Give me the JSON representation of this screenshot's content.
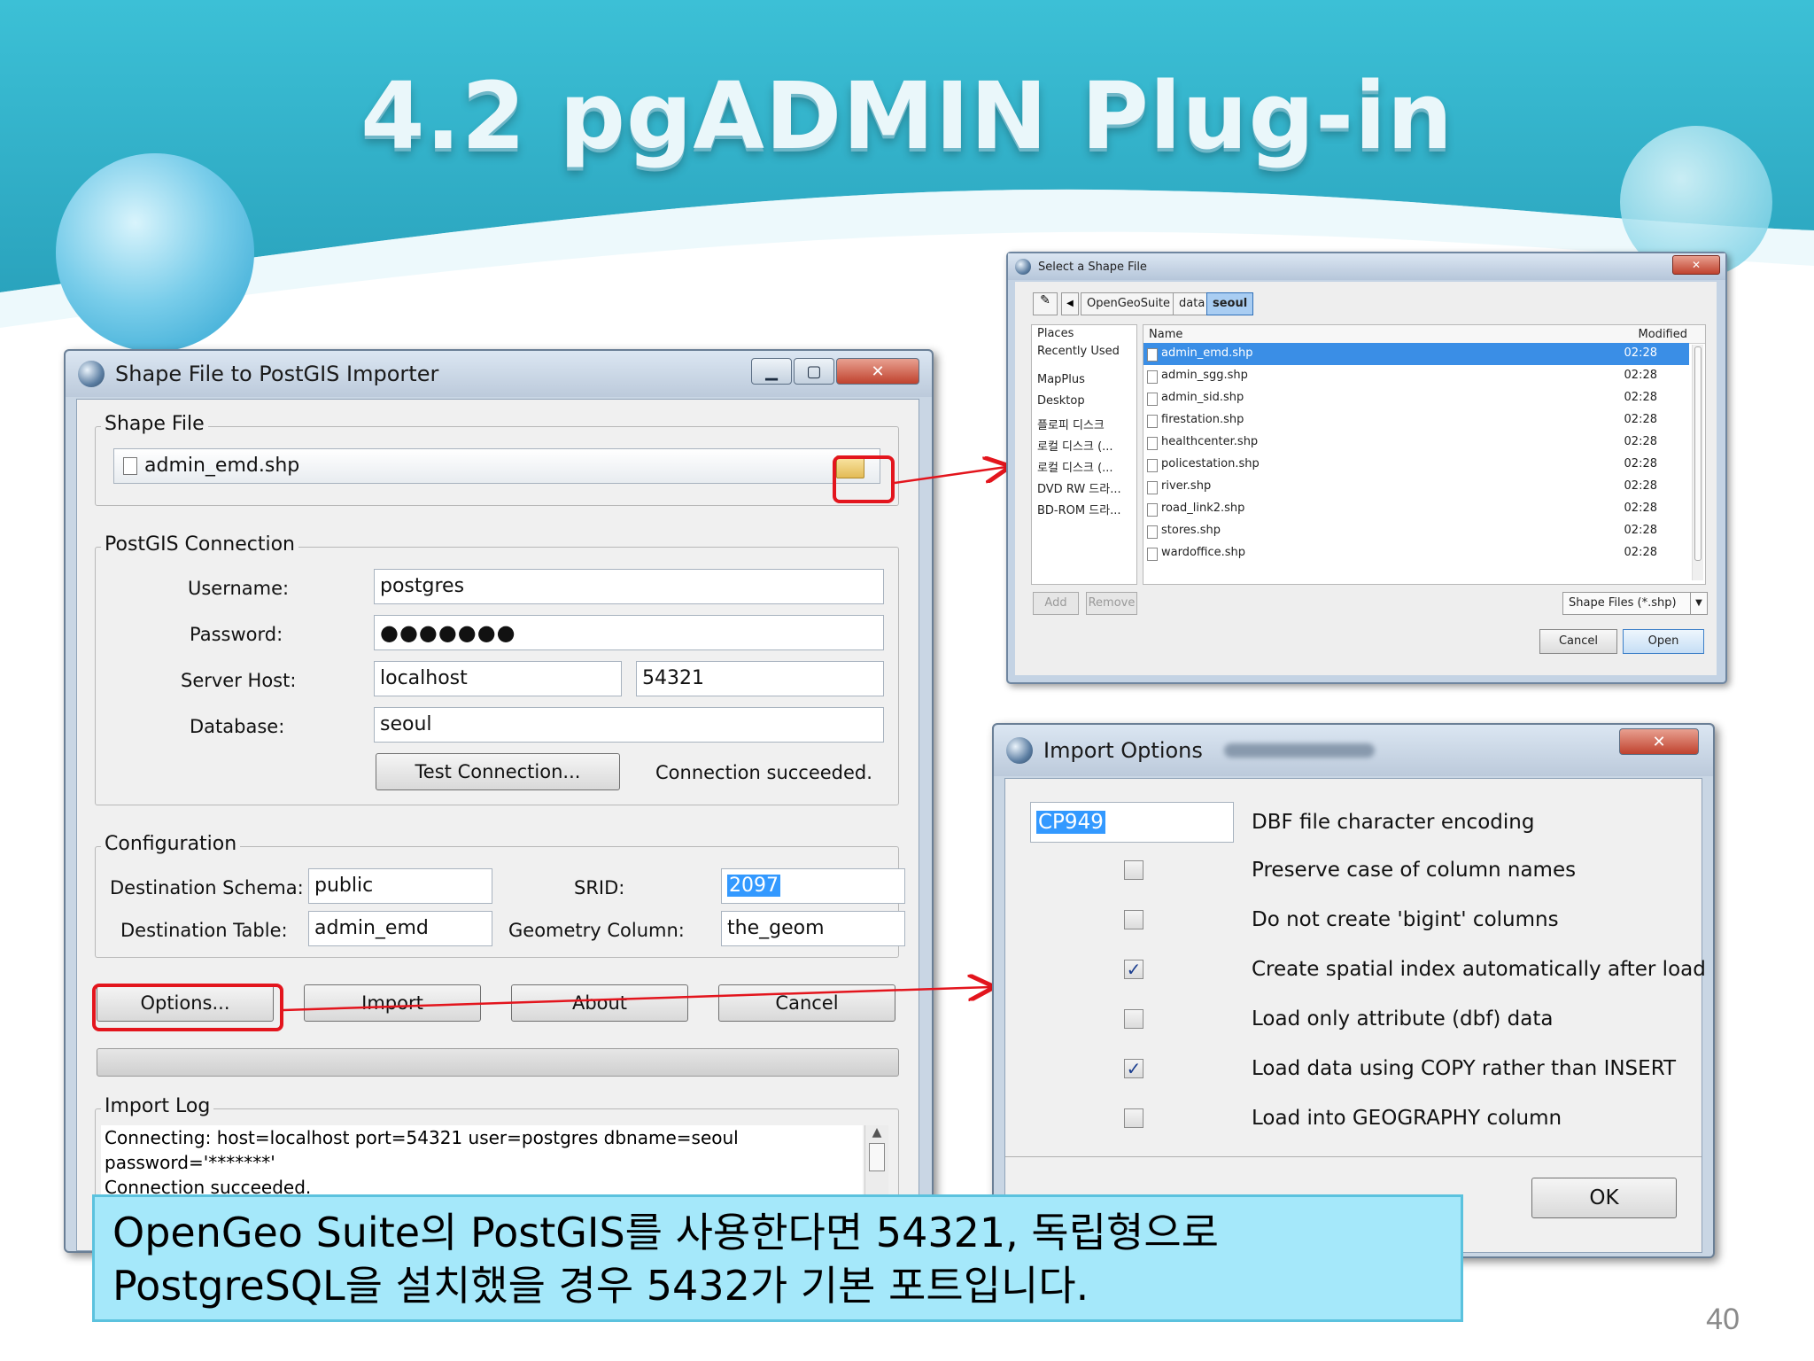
{
  "slide": {
    "title": "4.2 pgADMIN Plug-in",
    "page_number": "40",
    "callout_line1": "OpenGeo Suite의 PostGIS를 사용한다면 54321, 독립형으로",
    "callout_line2": "PostgreSQL을 설치했을 경우 5432가 기본 포트입니다."
  },
  "importer": {
    "title": "Shape File to PostGIS Importer",
    "shape_file_group": "Shape File",
    "shape_file_value": "admin_emd.shp",
    "connection_group": "PostGIS Connection",
    "username_label": "Username:",
    "username_value": "postgres",
    "password_label": "Password:",
    "password_value": "●●●●●●●",
    "server_host_label": "Server Host:",
    "host_value": "localhost",
    "port_value": "54321",
    "database_label": "Database:",
    "database_value": "seoul",
    "test_connection_button": "Test Connection...",
    "connection_status": "Connection succeeded.",
    "configuration_group": "Configuration",
    "dest_schema_label": "Destination Schema:",
    "dest_schema_value": "public",
    "srid_label": "SRID:",
    "srid_value": "2097",
    "dest_table_label": "Destination Table:",
    "dest_table_value": "admin_emd",
    "geom_column_label": "Geometry Column:",
    "geom_column_value": "the_geom",
    "options_button": "Options...",
    "import_button": "Import",
    "about_button": "About",
    "cancel_button": "Cancel",
    "import_log_group": "Import Log",
    "log_line1": "Connecting: host=localhost port=54321 user=postgres dbname=seoul",
    "log_line2": "password='*******'",
    "log_line3": "Connection succeeded."
  },
  "file_dialog": {
    "title": "Select a Shape File",
    "breadcrumbs": [
      "OpenGeoSuite",
      "data",
      "seoul"
    ],
    "places_header": "Places",
    "places": [
      "Recently Used",
      "MapPlus",
      "Desktop",
      "플로피 디스크",
      "로컬 디스크 (...",
      "로컬 디스크 (...",
      "DVD RW 드라...",
      "BD-ROM 드라..."
    ],
    "name_header": "Name",
    "modified_header": "Modified",
    "files": [
      {
        "name": "admin_emd.shp",
        "modified": "02:28"
      },
      {
        "name": "admin_sgg.shp",
        "modified": "02:28"
      },
      {
        "name": "admin_sid.shp",
        "modified": "02:28"
      },
      {
        "name": "firestation.shp",
        "modified": "02:28"
      },
      {
        "name": "healthcenter.shp",
        "modified": "02:28"
      },
      {
        "name": "policestation.shp",
        "modified": "02:28"
      },
      {
        "name": "river.shp",
        "modified": "02:28"
      },
      {
        "name": "road_link2.shp",
        "modified": "02:28"
      },
      {
        "name": "stores.shp",
        "modified": "02:28"
      },
      {
        "name": "wardoffice.shp",
        "modified": "02:28"
      }
    ],
    "add_button": "Add",
    "remove_button": "Remove",
    "filter_value": "Shape Files (*.shp)",
    "cancel_button": "Cancel",
    "open_button": "Open"
  },
  "import_options": {
    "title": "Import Options",
    "encoding_value": "CP949",
    "encoding_label": "DBF file character encoding",
    "options": [
      {
        "label": "Preserve case of column names",
        "checked": "false"
      },
      {
        "label": "Do not create 'bigint' columns",
        "checked": "false"
      },
      {
        "label": "Create spatial index automatically after load",
        "checked": "true"
      },
      {
        "label": "Load only attribute (dbf) data",
        "checked": "false"
      },
      {
        "label": "Load data using COPY rather than INSERT",
        "checked": "true"
      },
      {
        "label": "Load into GEOGRAPHY column",
        "checked": "false"
      }
    ],
    "ok_button": "OK"
  },
  "colors": {
    "header_teal": "#3fb9cf",
    "highlight_red": "#e3151d",
    "callout_fill": "#a5e8fa",
    "selection_blue": "#3399ff"
  }
}
